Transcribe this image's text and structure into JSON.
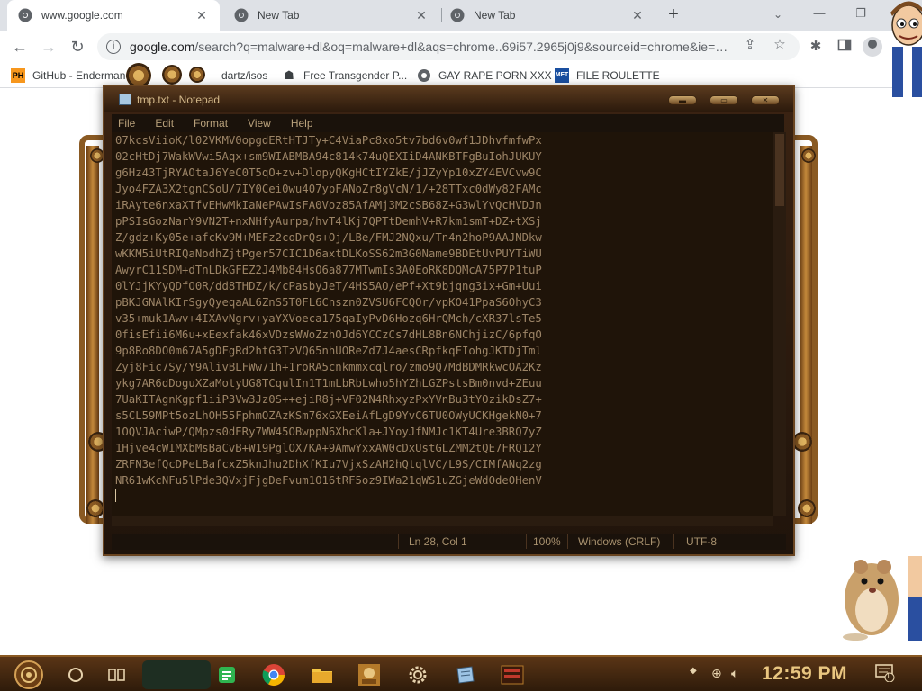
{
  "browser": {
    "tabs": [
      {
        "title": "www.google.com",
        "favicon": "chrome-icon",
        "active": true
      },
      {
        "title": "New Tab",
        "favicon": "chrome-icon",
        "active": false
      },
      {
        "title": "New Tab",
        "favicon": "chrome-icon",
        "active": false
      }
    ],
    "tab_close": "✕",
    "new_tab": "+",
    "tab_search": "⌄",
    "window_controls": {
      "minimize": "—",
      "restore": "❐",
      "close": "✕"
    },
    "nav": {
      "back": "←",
      "forward": "→",
      "reload": "↻"
    },
    "omnibox": {
      "host": "google.com",
      "path": "/search?q=malware+dl&oq=malware+dl&aqs=chrome..69i57.2965j0j9&sourceid=chrome&ie=…"
    },
    "bookmarks": [
      {
        "label": "GitHub - Endermanc",
        "icon": "ph-icon"
      },
      {
        "label": "dartz/isos",
        "icon": "folder-icon"
      },
      {
        "label": "Free Transgender P...",
        "icon": "mask-icon"
      },
      {
        "label": "GAY RAPE PORN XXX",
        "icon": "chrome-icon"
      },
      {
        "label": "FILE ROULETTE",
        "icon": "mft-icon"
      }
    ]
  },
  "notepad": {
    "title": "tmp.txt - Notepad",
    "menu": [
      "File",
      "Edit",
      "Format",
      "View",
      "Help"
    ],
    "lines": [
      "07kcsViioK/l02VKMV0opgdERtHTJTy+C4ViaPc8xo5tv7bd6v0wf1JDhvfmfwPx",
      "02cHtDj7WakWVwi5Aqx+sm9WIABMBA94c814k74uQEXIiD4ANKBTFgBuIohJUKUY",
      "g6Hz43TjRYAOtaJ6YeC0T5qO+zv+DlopyQKgHCtIYZkE/jJZyYp10xZY4EVCvw9C",
      "Jyo4FZA3X2tgnCSoU/7IY0Cei0wu407ypFANoZr8gVcN/1/+28TTxc0dWy82FAMc",
      "iRAyte6nxaXTfvEHwMkIaNePAwIsFA0Voz85AfAMj3M2cSB68Z+G3wlYvQcHVDJn",
      "pPSIsGozNarY9VN2T+nxNHfyAurpa/hvT4lKj7QPTtDemhV+R7km1smT+DZ+tXSj",
      "Z/gdz+Ky05e+afcKv9M+MEFz2coDrQs+Oj/LBe/FMJ2NQxu/Tn4n2hoP9AAJNDkw",
      "wKKM5iUtRIQaNodhZjtPger57CIC1D6axtDLKoSS62m3G0Name9BDEtUvPUYTiWU",
      "AwyrC11SDM+dTnLDkGFEZ2J4Mb84HsO6a877MTwmIs3A0EoRK8DQMcA75P7P1tuP",
      "0lYJjKYyQDfO0R/dd8THDZ/k/cPasbyJeT/4HS5AO/ePf+Xt9bjqng3ix+Gm+Uui",
      "pBKJGNAlKIrSgyQyeqaAL6ZnS5T0FL6Cnszn0ZVSU6FCQOr/vpKO41PpaS6OhyC3",
      "v35+muk1Awv+4IXAvNgrv+yaYXVoeca175qaIyPvD6Hozq6HrQMch/cXR37lsTe5",
      "0fisEfii6M6u+xEexfak46xVDzsWWoZzhOJd6YCCzCs7dHL8Bn6NChjizC/6pfqO",
      "9p8Ro8DO0m67A5gDFgRd2htG3TzVQ65nhUOReZd7J4aesCRpfkqFIohgJKTDjTml",
      "Zyj8Fic7Sy/Y9AlivBLFWw71h+1roRA5cnkmmxcqlro/zmo9Q7MdBDMRkwcOA2Kz",
      "ykg7AR6dDoguXZaMotyUG8TCqulIn1T1mLbRbLwho5hYZhLGZPstsBm0nvd+ZEuu",
      "7UaKITAgnKgpf1iiP3Vw3Jz0S++ejiR8j+VF02N4RhxyzPxYVnBu3tYOzikDsZ7+",
      "s5CL59MPt5ozLhOH55FphmOZAzKSm76xGXEeiAfLgD9YvC6TU0OWyUCKHgekN0+7",
      "1OQVJAciwP/QMpzs0dERy7WW45OBwppN6XhcKla+JYoyJfNMJc1KT4Ure3BRQ7yZ",
      "1Hjve4cWIMXbMsBaCvB+W19PglOX7KA+9AmwYxxAW0cDxUstGLZMM2tQE7FRQ12Y",
      "ZRFN3efQcDPeLBafcxZ5knJhu2DhXfKIu7VjxSzAH2hQtqlVC/L9S/CIMfANq2zg",
      "NR61wKcNFu5lPde3QVxjFjgDeFvum1O16tRF5oz9IWa21qWS1uZGjeWdOdeOHenV"
    ],
    "status": {
      "position": "Ln 28, Col 1",
      "zoom": "100%",
      "line_endings": "Windows (CRLF)",
      "encoding": "UTF-8"
    },
    "title_buttons": {
      "minimize": "▬",
      "maximize": "▭",
      "close": "✕"
    }
  },
  "taskbar": {
    "clock": "12:59 PM",
    "items": [
      "start-orb-icon",
      "cortana-circle-icon",
      "task-view-icon",
      "notes-icon",
      "chrome-icon",
      "file-explorer-icon",
      "game-icon",
      "settings-gear-icon",
      "notepad-icon",
      "app-icon"
    ],
    "notification_count": "1"
  },
  "colors": {
    "chrome_tab_bg": "#dee1e6",
    "notepad_bg": "#1f1409",
    "notepad_text": "#9c8466",
    "taskbar_brass": "#8a5a23",
    "clock": "#e9c680"
  }
}
